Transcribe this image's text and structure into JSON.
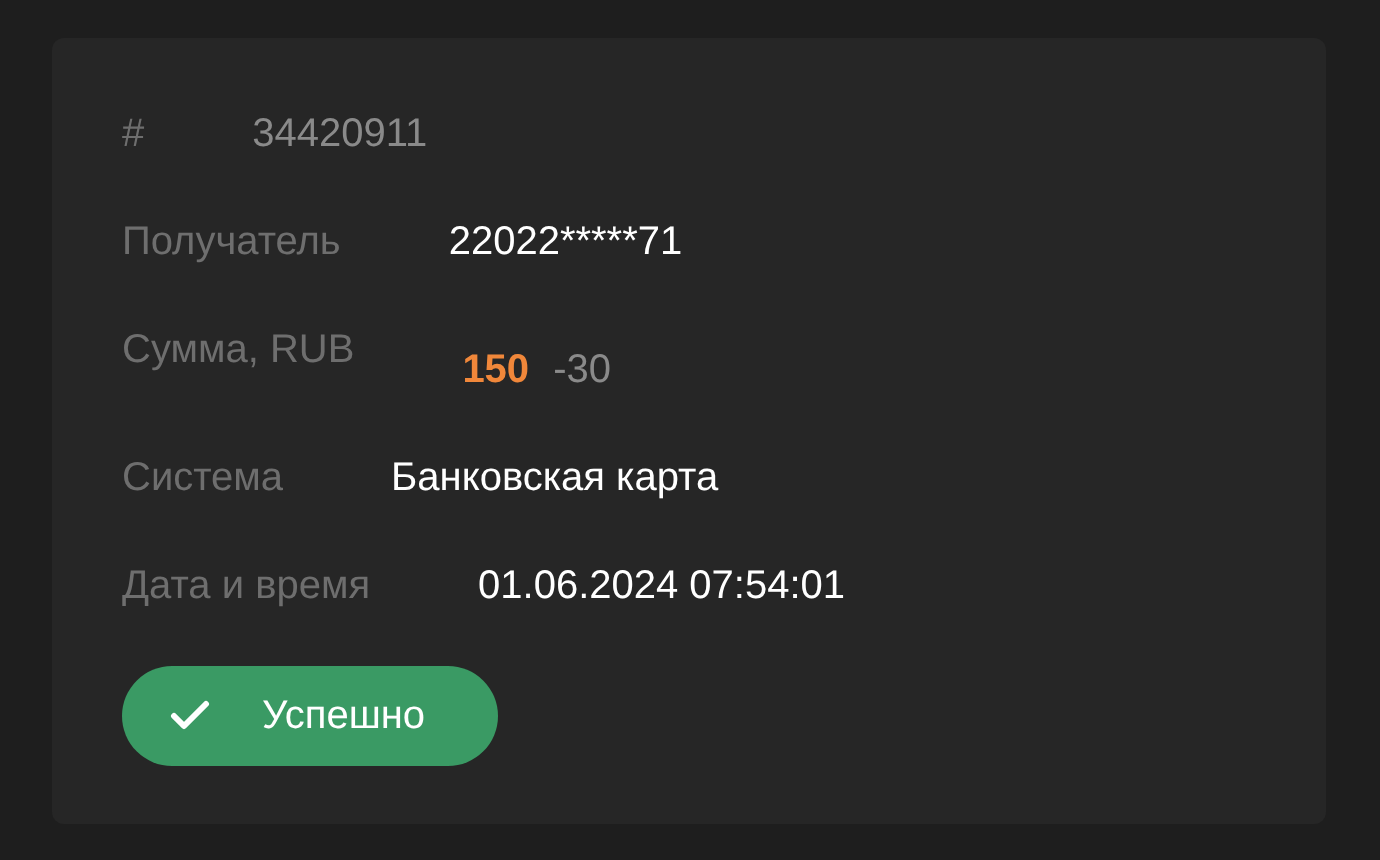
{
  "rows": [
    {
      "label": "#",
      "kind": "muted",
      "value": "34420911"
    },
    {
      "label": "Получатель",
      "kind": "text",
      "value": "22022*****71"
    },
    {
      "label": "Сумма, RUB",
      "kind": "amount",
      "value": "150",
      "fee": "-30"
    },
    {
      "label": "Система",
      "kind": "text",
      "value": "Банковская карта"
    },
    {
      "label": "Дата и время",
      "kind": "text",
      "value": "01.06.2024 07:54:01"
    }
  ],
  "status": {
    "kind": "success",
    "label": "Успешно"
  }
}
